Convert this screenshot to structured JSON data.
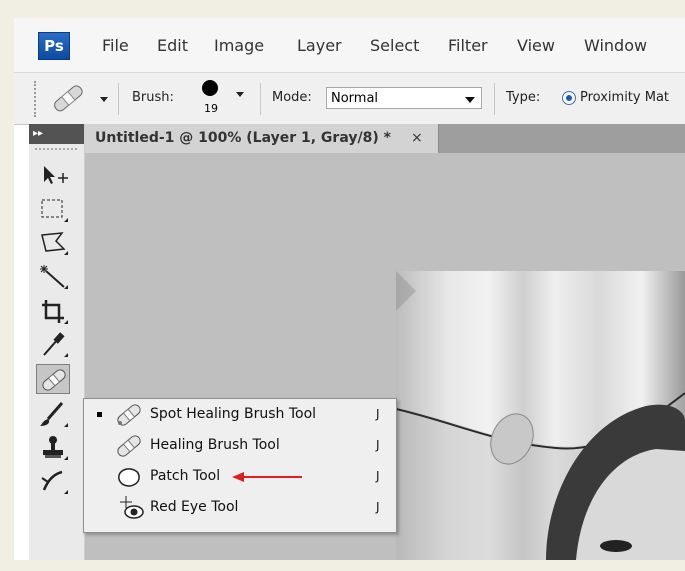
{
  "app": {
    "logo": "Ps"
  },
  "menu": [
    "File",
    "Edit",
    "Image",
    "Layer",
    "Select",
    "Filter",
    "View",
    "Window"
  ],
  "options": {
    "brush_label": "Brush:",
    "brush_size": "19",
    "mode_label": "Mode:",
    "mode_value": "Normal",
    "type_label": "Type:",
    "type_value": "Proximity Mat"
  },
  "toolbox": {
    "collapse_glyph": "▸▸"
  },
  "document": {
    "tab_title": "Untitled-1 @ 100% (Layer 1, Gray/8) *",
    "close_glyph": "×"
  },
  "flyout": {
    "items": [
      {
        "label": "Spot Healing Brush Tool",
        "shortcut": "J",
        "selected": true,
        "icon": "spot-healing-brush-icon"
      },
      {
        "label": "Healing Brush Tool",
        "shortcut": "J",
        "selected": false,
        "icon": "healing-brush-icon"
      },
      {
        "label": "Patch Tool",
        "shortcut": "J",
        "selected": false,
        "icon": "patch-icon"
      },
      {
        "label": "Red Eye Tool",
        "shortcut": "J",
        "selected": false,
        "icon": "red-eye-icon"
      }
    ]
  },
  "colors": {
    "annotation_arrow": "#e02020",
    "ps_blue": "#1f5bb5"
  }
}
